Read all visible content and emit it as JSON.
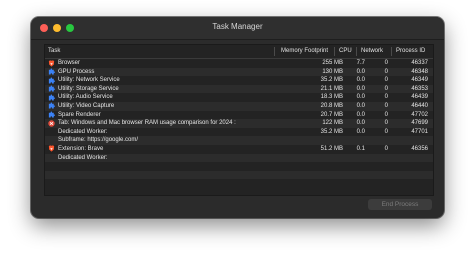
{
  "window": {
    "title": "Task Manager"
  },
  "columns": {
    "task": "Task",
    "memory": "Memory Footprint",
    "cpu": "CPU",
    "network": "Network",
    "pid": "Process ID"
  },
  "rows": [
    {
      "icon": "brave-lion-icon",
      "task": "Browser",
      "memory": "255 MB",
      "cpu": "7.7",
      "network": "0",
      "pid": "46337"
    },
    {
      "icon": "puzzle-icon",
      "task": "GPU Process",
      "memory": "130 MB",
      "cpu": "0.0",
      "network": "0",
      "pid": "46348"
    },
    {
      "icon": "puzzle-icon",
      "task": "Utility: Network Service",
      "memory": "35.2 MB",
      "cpu": "0.0",
      "network": "0",
      "pid": "46349"
    },
    {
      "icon": "puzzle-icon",
      "task": "Utility: Storage Service",
      "memory": "21.1 MB",
      "cpu": "0.0",
      "network": "0",
      "pid": "46353"
    },
    {
      "icon": "puzzle-icon",
      "task": "Utility: Audio Service",
      "memory": "18.3 MB",
      "cpu": "0.0",
      "network": "0",
      "pid": "46439"
    },
    {
      "icon": "puzzle-icon",
      "task": "Utility: Video Capture",
      "memory": "20.8 MB",
      "cpu": "0.0",
      "network": "0",
      "pid": "46440"
    },
    {
      "icon": "puzzle-icon",
      "task": "Spare Renderer",
      "memory": "20.7 MB",
      "cpu": "0.0",
      "network": "0",
      "pid": "47702"
    },
    {
      "icon": "red-tab-icon",
      "task": "Tab: Windows and Mac browser RAM usage comparison for 2024 :",
      "memory": "122 MB",
      "cpu": "0.0",
      "network": "0",
      "pid": "47699"
    },
    {
      "icon": "",
      "task": "Dedicated Worker:",
      "memory": "35.2 MB",
      "cpu": "0.0",
      "network": "0",
      "pid": "47701"
    },
    {
      "icon": "",
      "task": "Subframe: https://google.com/",
      "memory": "",
      "cpu": "",
      "network": "",
      "pid": ""
    },
    {
      "icon": "brave-lion-icon",
      "task": "Extension: Brave",
      "memory": "51.2 MB",
      "cpu": "0.1",
      "network": "0",
      "pid": "46356"
    },
    {
      "icon": "",
      "task": "Dedicated Worker:",
      "memory": "",
      "cpu": "",
      "network": "",
      "pid": ""
    }
  ],
  "buttons": {
    "end_process": "End Process"
  }
}
